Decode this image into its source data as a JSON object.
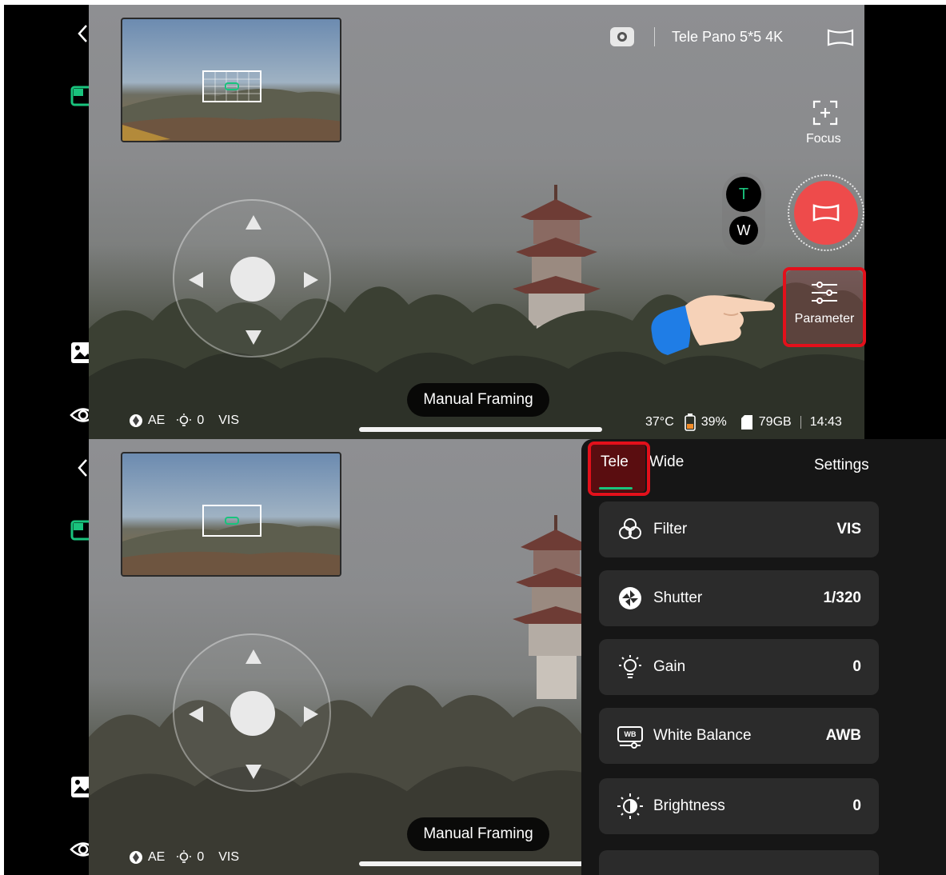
{
  "top": {
    "mode_title": "Tele Pano 5*5 4K",
    "focus_label": "Focus",
    "zoom_tele": "T",
    "zoom_wide": "W",
    "parameter_label": "Parameter",
    "framing_label": "Manual Framing",
    "status_left": {
      "ae": "AE",
      "gain": "0",
      "filter": "VIS"
    },
    "status_right": {
      "temperature": "37°C",
      "battery": "39%",
      "storage": "79GB",
      "time": "14:43"
    }
  },
  "bottom": {
    "framing_label": "Manual Framing",
    "status_left": {
      "ae": "AE",
      "gain": "0",
      "filter": "VIS"
    },
    "panel": {
      "tabs": [
        "Tele",
        "Wide"
      ],
      "settings_label": "Settings",
      "rows": [
        {
          "label": "Filter",
          "value": "VIS",
          "icon": "filter-icon"
        },
        {
          "label": "Shutter",
          "value": "1/320",
          "icon": "shutter-icon"
        },
        {
          "label": "Gain",
          "value": "0",
          "icon": "gain-bulb-icon"
        },
        {
          "label": "White Balance",
          "value": "AWB",
          "icon": "white-balance-icon"
        },
        {
          "label": "Brightness",
          "value": "0",
          "icon": "brightness-icon"
        }
      ],
      "wb_badge": "WB"
    }
  },
  "colors": {
    "accent_green": "#19c37d",
    "record_red": "#ee4b4b",
    "highlight_red": "#e3101b"
  }
}
